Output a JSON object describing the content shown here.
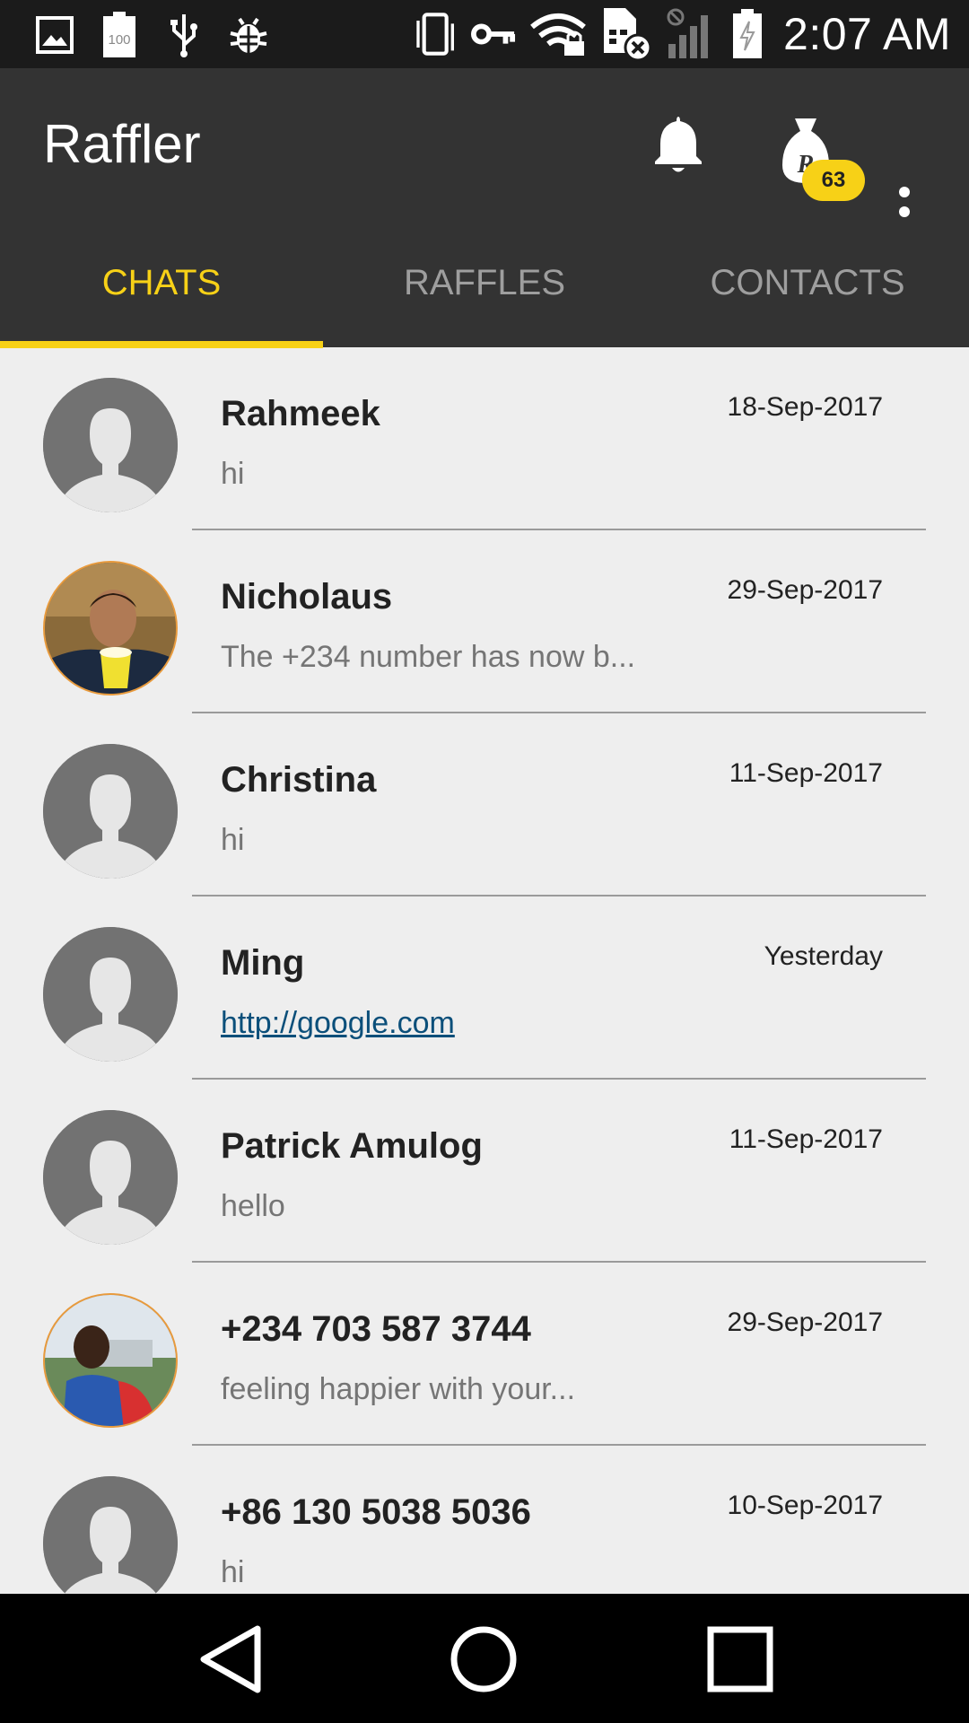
{
  "status_bar": {
    "time": "2:07 AM",
    "battery_saver_text": "100",
    "icons": [
      "image-icon",
      "battery-100-icon",
      "usb-icon",
      "bug-icon",
      "vibrate-icon",
      "key-icon",
      "wifi-locked-icon",
      "sim-off-icon",
      "signal-blocked-icon",
      "battery-charging-icon"
    ]
  },
  "app_bar": {
    "title": "Raffler",
    "badge_count": "63",
    "bag_letter": "R",
    "accent_color": "#f7d117"
  },
  "tabs": [
    {
      "label": "CHATS",
      "active": true
    },
    {
      "label": "RAFFLES",
      "active": false
    },
    {
      "label": "CONTACTS",
      "active": false
    }
  ],
  "chats": [
    {
      "name": "Rahmeek",
      "message": "hi",
      "date": "18-Sep-2017",
      "avatar": "default"
    },
    {
      "name": "Nicholaus",
      "message": "The +234 number has now b...",
      "date": "29-Sep-2017",
      "avatar": "photo"
    },
    {
      "name": "Christina",
      "message": "hi",
      "date": "11-Sep-2017",
      "avatar": "default"
    },
    {
      "name": "Ming",
      "message": "http://google.com",
      "date": "Yesterday",
      "avatar": "default",
      "is_link": true
    },
    {
      "name": "Patrick Amulog",
      "message": "hello",
      "date": "11-Sep-2017",
      "avatar": "default"
    },
    {
      "name": "+234 703 587 3744",
      "message": "feeling happier with your...",
      "date": "29-Sep-2017",
      "avatar": "photo"
    },
    {
      "name": "+86 130 5038 5036",
      "message": "hi",
      "date": "10-Sep-2017",
      "avatar": "default"
    }
  ]
}
